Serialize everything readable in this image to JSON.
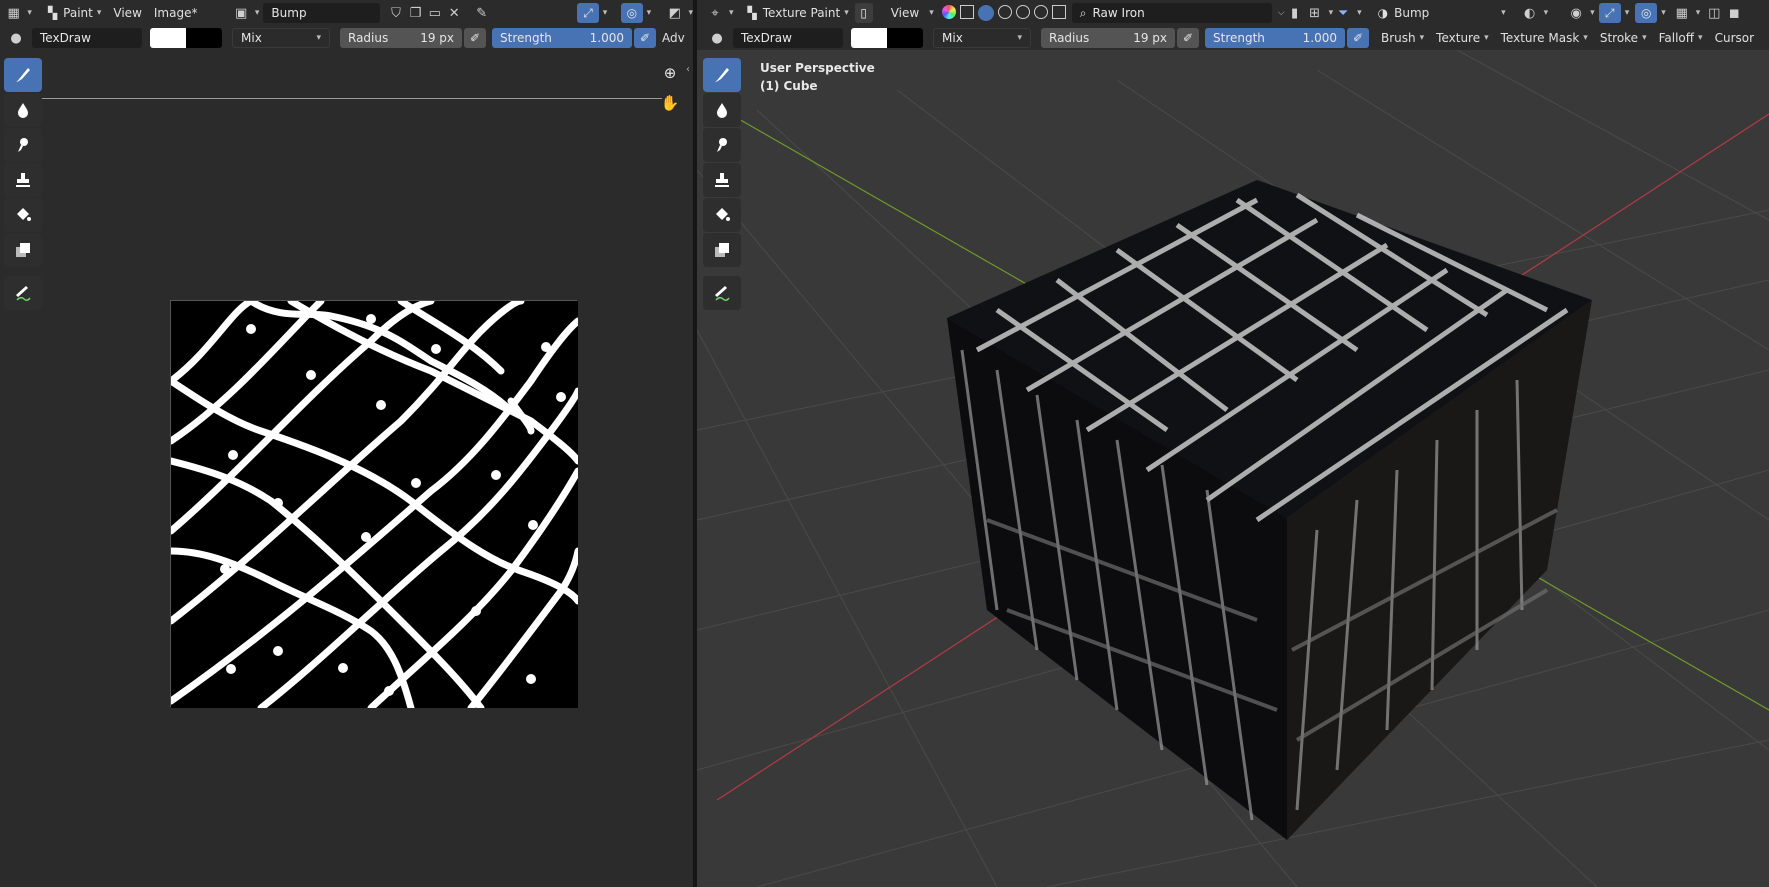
{
  "left_editor": {
    "header": {
      "mode_label": "Paint",
      "menu_view": "View",
      "menu_image": "Image*",
      "image_name": "Bump"
    },
    "tool_settings": {
      "brush_name": "TexDraw",
      "blend_mode": "Mix",
      "radius_label": "Radius",
      "radius_value": "19 px",
      "strength_label": "Strength",
      "strength_value": "1.000",
      "advanced_label": "Adv"
    }
  },
  "right_editor": {
    "header": {
      "mode_label": "Texture Paint",
      "menu_view": "View",
      "search_text": "Raw Iron",
      "texture_slot": "Bump"
    },
    "tool_settings": {
      "brush_name": "TexDraw",
      "blend_mode": "Mix",
      "radius_label": "Radius",
      "radius_value": "19 px",
      "strength_label": "Strength",
      "strength_value": "1.000",
      "panels": [
        "Brush",
        "Texture",
        "Texture Mask",
        "Stroke",
        "Falloff",
        "Cursor"
      ]
    },
    "viewport": {
      "perspective_label": "User Perspective",
      "object_label": "(1) Cube"
    }
  },
  "tools": [
    "draw-brush",
    "soften",
    "smear",
    "clone",
    "fill",
    "mask",
    "annotate"
  ],
  "colors": {
    "accent_blue": "#4772b3",
    "primary_color": "#ffffff",
    "secondary_color": "#000000",
    "axis_x": "#b53a45",
    "axis_y": "#6e9a28"
  }
}
